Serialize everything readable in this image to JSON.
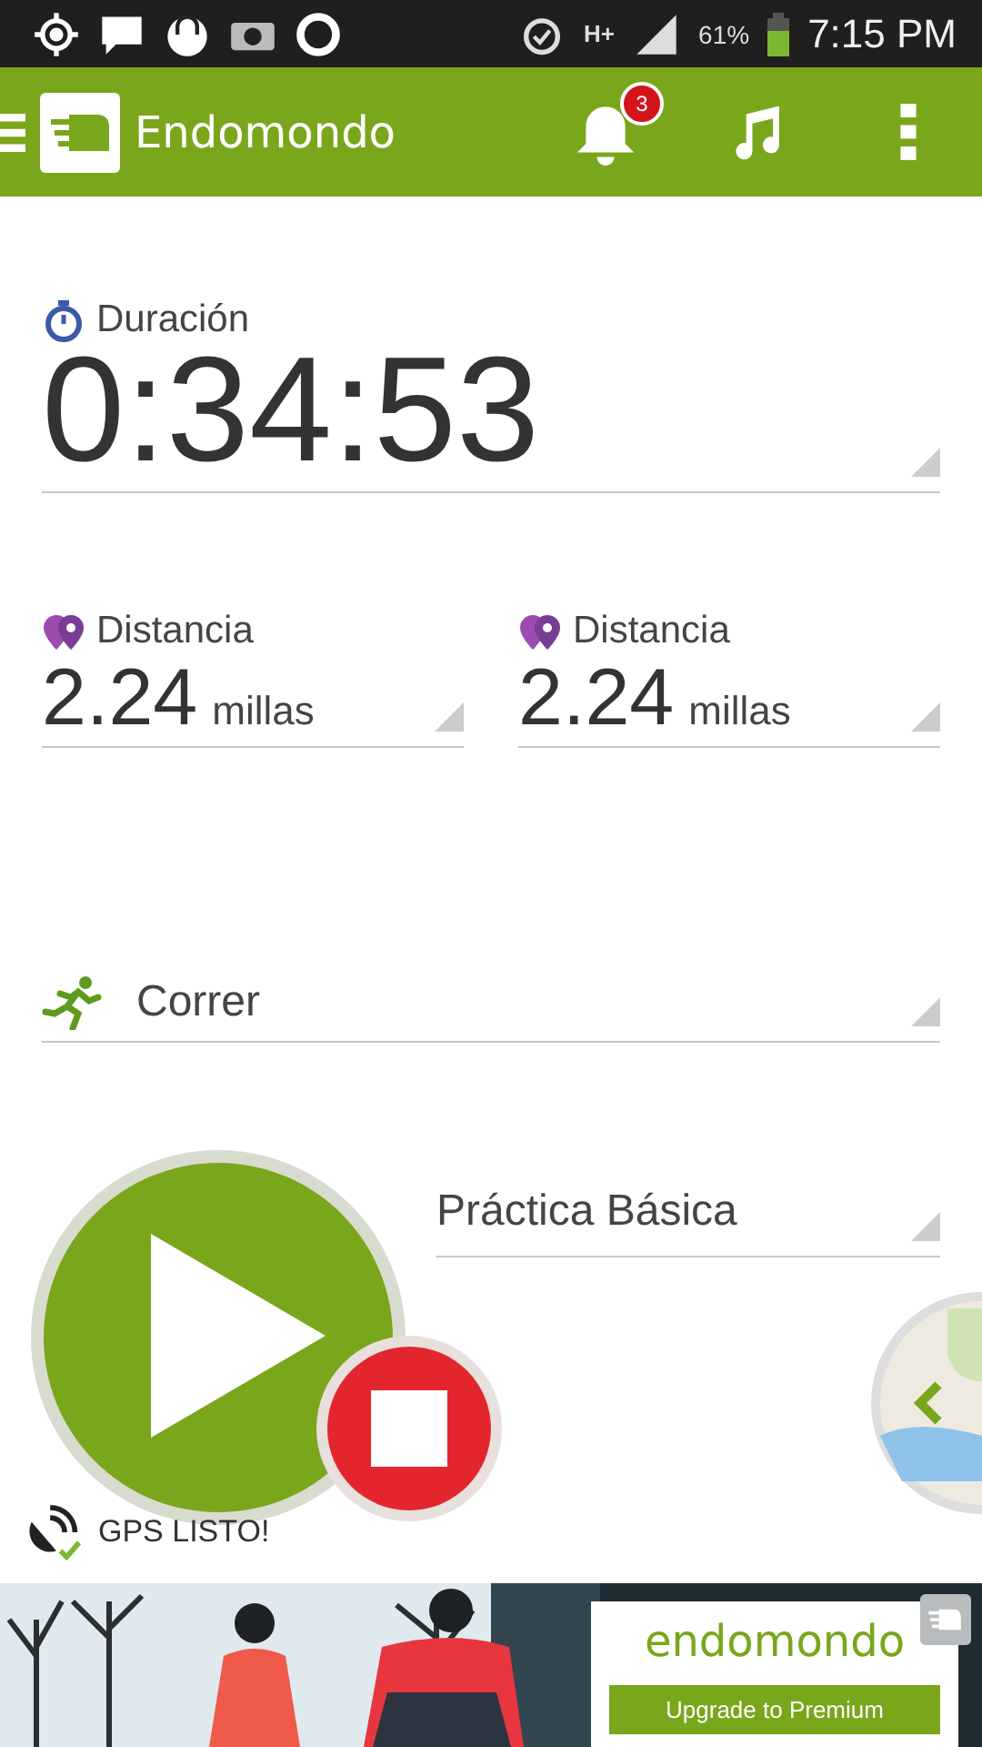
{
  "status_bar": {
    "network": "H+",
    "battery": "61%",
    "time": "7:15 PM"
  },
  "app_bar": {
    "title": "Endomondo",
    "notification_count": "3"
  },
  "duration": {
    "label": "Duración",
    "value": "0:34:53"
  },
  "distances": [
    {
      "label": "Distancia",
      "value": "2.24",
      "unit": "millas"
    },
    {
      "label": "Distancia",
      "value": "2.24",
      "unit": "millas"
    }
  ],
  "sport": {
    "value": "Correr"
  },
  "workout": {
    "value": "Práctica Básica"
  },
  "gps": {
    "label": "GPS LISTO!"
  },
  "ad": {
    "brand": "endomondo",
    "button": "Upgrade to Premium"
  }
}
